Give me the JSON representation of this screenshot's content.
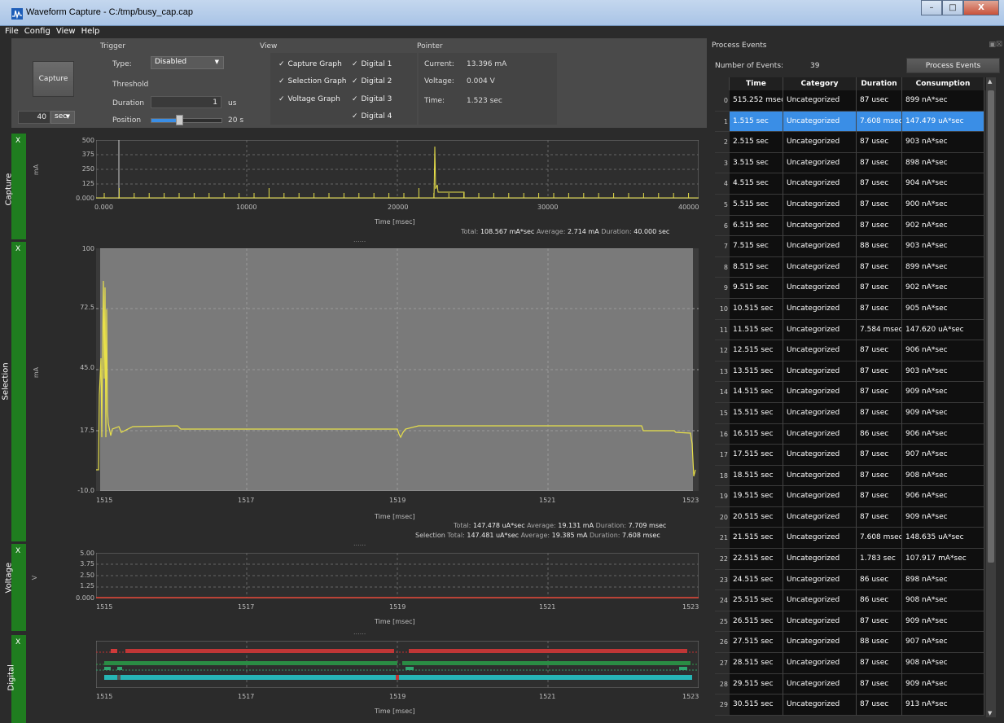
{
  "window": {
    "title": "Waveform Capture - C:/tmp/busy_cap.cap"
  },
  "menu": [
    "File",
    "Config",
    "View",
    "Help"
  ],
  "toolbar": {
    "capture_label": "Capture",
    "duration_value": "40",
    "duration_unit": "sec",
    "trigger": {
      "title": "Trigger",
      "type_label": "Type:",
      "type_value": "Disabled",
      "threshold_label": "Threshold",
      "duration_label": "Duration",
      "duration_value": "1",
      "duration_unit": "us",
      "position_label": "Position",
      "position_value": "20 s",
      "position_fraction": 0.5
    },
    "view": {
      "title": "View",
      "checks": [
        {
          "label": "Capture Graph",
          "checked": true
        },
        {
          "label": "Selection Graph",
          "checked": true
        },
        {
          "label": "Voltage Graph",
          "checked": true
        },
        {
          "label": "Digital 1",
          "checked": true
        },
        {
          "label": "Digital 2",
          "checked": true
        },
        {
          "label": "Digital 3",
          "checked": true
        },
        {
          "label": "Digital 4",
          "checked": true
        }
      ]
    },
    "pointer": {
      "title": "Pointer",
      "current_label": "Current:",
      "current_value": "13.396 mA",
      "voltage_label": "Voltage:",
      "voltage_value": "0.004 V",
      "time_label": "Time:",
      "time_value": "1.523 sec"
    }
  },
  "panels": {
    "close": "X",
    "capture": {
      "label": "Capture",
      "unit": "mA",
      "yticks": [
        "500",
        "375",
        "250",
        "125",
        "0.000"
      ],
      "xticks": [
        "0.000",
        "10000",
        "20000",
        "30000",
        "40000"
      ],
      "xlabel": "Time [msec]",
      "stats": {
        "total_label": "Total:",
        "total": "108.567 mA*sec",
        "avg_label": "Average:",
        "avg": "2.714 mA",
        "dur_label": "Duration:",
        "dur": "40.000 sec"
      }
    },
    "selection": {
      "label": "Selection",
      "unit": "mA",
      "yticks": [
        "100",
        "72.5",
        "45.0",
        "17.5",
        "-10.0"
      ],
      "xticks": [
        "1515",
        "1517",
        "1519",
        "1521",
        "1523"
      ],
      "xlabel": "Time [msec]",
      "stats1": {
        "total_label": "Total:",
        "total": "147.478 uA*sec",
        "avg_label": "Average:",
        "avg": "19.131 mA",
        "dur_label": "Duration:",
        "dur": "7.709 msec"
      },
      "stats2": {
        "sel_label": "Selection",
        "total_label": "Total:",
        "total": "147.481 uA*sec",
        "avg_label": "Average:",
        "avg": "19.385 mA",
        "dur_label": "Duration:",
        "dur": "7.608 msec"
      }
    },
    "voltage": {
      "label": "Voltage",
      "unit": "V",
      "yticks": [
        "5.00",
        "3.75",
        "2.50",
        "1.25",
        "0.000"
      ],
      "xticks": [
        "1515",
        "1517",
        "1519",
        "1521",
        "1523"
      ],
      "xlabel": "Time [msec]"
    },
    "digital": {
      "label": "Digital",
      "xticks": [
        "1515",
        "1517",
        "1519",
        "1521",
        "1523"
      ],
      "xlabel": "Time [msec]"
    },
    "splitter": "......"
  },
  "events": {
    "title": "Process Events",
    "count_label": "Number of Events:",
    "count": "39",
    "button": "Process Events",
    "columns": [
      "Time",
      "Category",
      "Duration",
      "Consumption"
    ],
    "selected_index": 1,
    "rows": [
      {
        "i": "0",
        "time": "515.252 msec",
        "cat": "Uncategorized",
        "dur": "87 usec",
        "cons": "899 nA*sec"
      },
      {
        "i": "1",
        "time": "1.515 sec",
        "cat": "Uncategorized",
        "dur": "7.608 msec",
        "cons": "147.479 uA*sec"
      },
      {
        "i": "2",
        "time": "2.515 sec",
        "cat": "Uncategorized",
        "dur": "87 usec",
        "cons": "903 nA*sec"
      },
      {
        "i": "3",
        "time": "3.515 sec",
        "cat": "Uncategorized",
        "dur": "87 usec",
        "cons": "898 nA*sec"
      },
      {
        "i": "4",
        "time": "4.515 sec",
        "cat": "Uncategorized",
        "dur": "87 usec",
        "cons": "904 nA*sec"
      },
      {
        "i": "5",
        "time": "5.515 sec",
        "cat": "Uncategorized",
        "dur": "87 usec",
        "cons": "900 nA*sec"
      },
      {
        "i": "6",
        "time": "6.515 sec",
        "cat": "Uncategorized",
        "dur": "87 usec",
        "cons": "902 nA*sec"
      },
      {
        "i": "7",
        "time": "7.515 sec",
        "cat": "Uncategorized",
        "dur": "88 usec",
        "cons": "903 nA*sec"
      },
      {
        "i": "8",
        "time": "8.515 sec",
        "cat": "Uncategorized",
        "dur": "87 usec",
        "cons": "899 nA*sec"
      },
      {
        "i": "9",
        "time": "9.515 sec",
        "cat": "Uncategorized",
        "dur": "87 usec",
        "cons": "902 nA*sec"
      },
      {
        "i": "10",
        "time": "10.515 sec",
        "cat": "Uncategorized",
        "dur": "87 usec",
        "cons": "905 nA*sec"
      },
      {
        "i": "11",
        "time": "11.515 sec",
        "cat": "Uncategorized",
        "dur": "7.584 msec",
        "cons": "147.620 uA*sec"
      },
      {
        "i": "12",
        "time": "12.515 sec",
        "cat": "Uncategorized",
        "dur": "87 usec",
        "cons": "906 nA*sec"
      },
      {
        "i": "13",
        "time": "13.515 sec",
        "cat": "Uncategorized",
        "dur": "87 usec",
        "cons": "903 nA*sec"
      },
      {
        "i": "14",
        "time": "14.515 sec",
        "cat": "Uncategorized",
        "dur": "87 usec",
        "cons": "909 nA*sec"
      },
      {
        "i": "15",
        "time": "15.515 sec",
        "cat": "Uncategorized",
        "dur": "87 usec",
        "cons": "909 nA*sec"
      },
      {
        "i": "16",
        "time": "16.515 sec",
        "cat": "Uncategorized",
        "dur": "86 usec",
        "cons": "906 nA*sec"
      },
      {
        "i": "17",
        "time": "17.515 sec",
        "cat": "Uncategorized",
        "dur": "87 usec",
        "cons": "907 nA*sec"
      },
      {
        "i": "18",
        "time": "18.515 sec",
        "cat": "Uncategorized",
        "dur": "87 usec",
        "cons": "908 nA*sec"
      },
      {
        "i": "19",
        "time": "19.515 sec",
        "cat": "Uncategorized",
        "dur": "87 usec",
        "cons": "906 nA*sec"
      },
      {
        "i": "20",
        "time": "20.515 sec",
        "cat": "Uncategorized",
        "dur": "87 usec",
        "cons": "909 nA*sec"
      },
      {
        "i": "21",
        "time": "21.515 sec",
        "cat": "Uncategorized",
        "dur": "7.608 msec",
        "cons": "148.635 uA*sec"
      },
      {
        "i": "22",
        "time": "22.515 sec",
        "cat": "Uncategorized",
        "dur": "1.783 sec",
        "cons": "107.917 mA*sec"
      },
      {
        "i": "23",
        "time": "24.515 sec",
        "cat": "Uncategorized",
        "dur": "86 usec",
        "cons": "898 nA*sec"
      },
      {
        "i": "24",
        "time": "25.515 sec",
        "cat": "Uncategorized",
        "dur": "86 usec",
        "cons": "908 nA*sec"
      },
      {
        "i": "25",
        "time": "26.515 sec",
        "cat": "Uncategorized",
        "dur": "87 usec",
        "cons": "909 nA*sec"
      },
      {
        "i": "26",
        "time": "27.515 sec",
        "cat": "Uncategorized",
        "dur": "88 usec",
        "cons": "907 nA*sec"
      },
      {
        "i": "27",
        "time": "28.515 sec",
        "cat": "Uncategorized",
        "dur": "87 usec",
        "cons": "908 nA*sec"
      },
      {
        "i": "28",
        "time": "29.515 sec",
        "cat": "Uncategorized",
        "dur": "87 usec",
        "cons": "909 nA*sec"
      },
      {
        "i": "29",
        "time": "30.515 sec",
        "cat": "Uncategorized",
        "dur": "87 usec",
        "cons": "913 nA*sec"
      }
    ]
  },
  "colors": {
    "accent": "#3a8ee6",
    "strip": "#1f7d1f",
    "trace": "#d8d24a",
    "voltage": "#e04030"
  }
}
